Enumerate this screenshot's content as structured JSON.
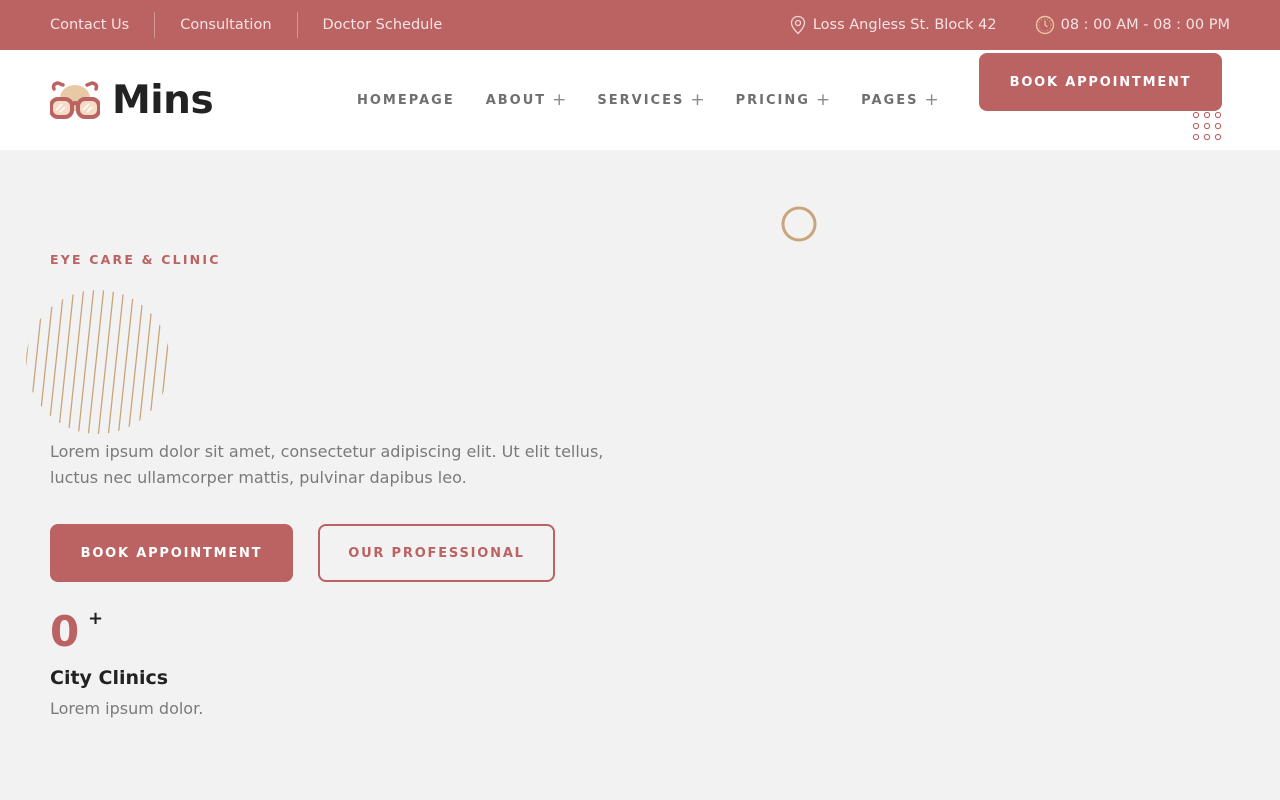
{
  "topbar": {
    "links": [
      "Contact Us",
      "Consultation",
      "Doctor Schedule"
    ],
    "address": "Loss Angless St. Block 42",
    "hours": "08 : 00 AM - 08 : 00 PM"
  },
  "header": {
    "logo_text": "Mins",
    "nav": [
      {
        "label": "HOMEPAGE",
        "has_submenu": false
      },
      {
        "label": "ABOUT",
        "has_submenu": true,
        "submenu_icon": "+"
      },
      {
        "label": "SERVICES",
        "has_submenu": true,
        "submenu_icon": "+"
      },
      {
        "label": "PRICING",
        "has_submenu": true,
        "submenu_icon": "+"
      },
      {
        "label": "PAGES",
        "has_submenu": true,
        "submenu_icon": "+"
      }
    ],
    "cta_label": "BOOK APPOINTMENT"
  },
  "hero": {
    "subtitle": "EYE CARE & CLINIC",
    "description": "Lorem ipsum dolor sit amet, consectetur adipiscing elit. Ut elit tellus, luctus nec ullamcorper mattis, pulvinar dapibus leo.",
    "primary_button": "BOOK APPOINTMENT",
    "secondary_button": "OUR PROFESSIONAL"
  },
  "stat": {
    "value": "0",
    "suffix": "+",
    "title": "City Clinics",
    "description": "Lorem ipsum dolor."
  },
  "icons": {
    "location": "location-pin-icon",
    "clock": "clock-icon",
    "logo": "glasses-logo-icon"
  },
  "colors": {
    "accent": "#bb6262",
    "decor": "#c9a57a",
    "background": "#f2f2f2"
  }
}
